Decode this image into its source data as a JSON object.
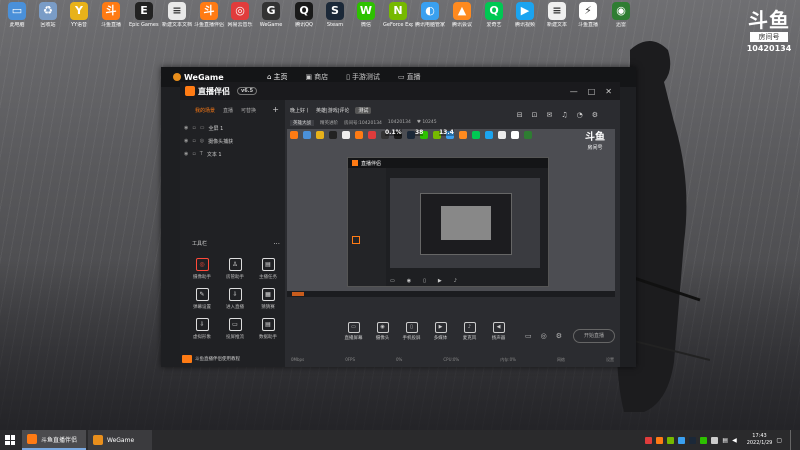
{
  "desktop": {
    "icons": [
      {
        "label": "此电脑",
        "color": "#4a90d9",
        "glyph": "▭"
      },
      {
        "label": "回收站",
        "color": "#7a9cc6",
        "glyph": "♻"
      },
      {
        "label": "YY语音",
        "color": "#e8b21a",
        "glyph": "Y"
      },
      {
        "label": "斗鱼直播",
        "color": "#ff7b14",
        "glyph": "斗"
      },
      {
        "label": "Epic Games Launcher",
        "color": "#222222",
        "glyph": "E"
      },
      {
        "label": "新建文本文档",
        "color": "#e9e9e9",
        "glyph": "≡"
      },
      {
        "label": "斗鱼直播伴侣",
        "color": "#ff7b14",
        "glyph": "斗"
      },
      {
        "label": "网易云音乐",
        "color": "#e03c3c",
        "glyph": "◎"
      },
      {
        "label": "WeGame",
        "color": "#333333",
        "glyph": "G"
      },
      {
        "label": "腾讯QQ",
        "color": "#1a1a1a",
        "glyph": "Q"
      },
      {
        "label": "Steam",
        "color": "#1b2838",
        "glyph": "S"
      },
      {
        "label": "微信",
        "color": "#2dc100",
        "glyph": "W"
      },
      {
        "label": "GeForce Experience",
        "color": "#76b900",
        "glyph": "N"
      },
      {
        "label": "腾讯电脑管家",
        "color": "#3aa0f0",
        "glyph": "◐"
      },
      {
        "label": "腾讯会议",
        "color": "#ff8a1f",
        "glyph": "▲"
      },
      {
        "label": "爱奇艺",
        "color": "#00c853",
        "glyph": "Q"
      },
      {
        "label": "腾讯视频",
        "color": "#1ba4f0",
        "glyph": "▶"
      },
      {
        "label": "新建文本",
        "color": "#f0f0f0",
        "glyph": "≡"
      },
      {
        "label": "斗鱼直播",
        "color": "#ffffff",
        "glyph": "⚡"
      },
      {
        "label": "迅雷",
        "color": "#2e7d32",
        "glyph": "◉"
      }
    ],
    "watermark": {
      "logo": "斗鱼",
      "label": "房间号",
      "room": "10420134"
    }
  },
  "wegame": {
    "brand": "WeGame",
    "nav": [
      "主页",
      "商店",
      "手游测试",
      "直播"
    ]
  },
  "app": {
    "brand": "直播伴侣",
    "version": "v6.5",
    "window_controls": [
      "—",
      "□",
      "✕"
    ],
    "tabs": [
      "我的场景",
      "直播",
      "可替换"
    ],
    "add": "+",
    "scenes": [
      "全屏 1",
      "摄像头捕获",
      "文本 1"
    ],
    "tools_header": "工具栏",
    "tools_more": "···",
    "tools": [
      {
        "label": "摄像助手",
        "glyph": "◎",
        "hot": true
      },
      {
        "label": "房管助手",
        "glyph": "♙",
        "hot": false
      },
      {
        "label": "主播任务",
        "glyph": "▤",
        "hot": false
      },
      {
        "label": "弹幕设置",
        "glyph": "✎",
        "hot": false
      },
      {
        "label": "进入直播",
        "glyph": "⇩",
        "hot": false
      },
      {
        "label": "猜猜赛",
        "glyph": "▦",
        "hot": false
      },
      {
        "label": "虚拟形象",
        "glyph": "⇩",
        "hot": false
      },
      {
        "label": "投屏推流",
        "glyph": "▭",
        "hot": false
      },
      {
        "label": "数据助手",
        "glyph": "▤",
        "hot": false
      }
    ],
    "footer": "斗鱼直播伴侣使用教程",
    "live_title": "晚上好丨",
    "live_category": "英雄|游戏|评论",
    "live_badge": "测试",
    "meta": [
      "英雄大战",
      "精英进阶",
      "房间号:10420134",
      "10420134",
      "10245"
    ],
    "right_icons": [
      "⊟",
      "⊡",
      "✉",
      "♫",
      "◔",
      "⚙"
    ],
    "controls": [
      {
        "label": "直播屏幕",
        "glyph": "▭"
      },
      {
        "label": "摄像头",
        "glyph": "◉"
      },
      {
        "label": "手机投屏",
        "glyph": "▯"
      },
      {
        "label": "多媒体",
        "glyph": "▶"
      },
      {
        "label": "麦克风",
        "glyph": "♪"
      },
      {
        "label": "扬声器",
        "glyph": "◀"
      }
    ],
    "start_button": "开始直播",
    "side_icons": [
      "▭",
      "◎",
      "⚙"
    ],
    "stats": [
      "0Mbps",
      "0FPS",
      "0%",
      "CPU:0%",
      "内存:0%",
      "网络",
      "设置"
    ]
  },
  "preview": {
    "overlay_numbers": [
      "0.1%",
      "38",
      "13.4"
    ],
    "watermark": {
      "logo": "斗鱼",
      "room": "房间号"
    }
  },
  "taskbar": {
    "items": [
      {
        "label": "斗鱼直播伴侣",
        "color": "#ff7b14"
      },
      {
        "label": "WeGame",
        "color": "#e98f1c"
      }
    ],
    "time": "17:43",
    "date": "2022/1/29"
  }
}
